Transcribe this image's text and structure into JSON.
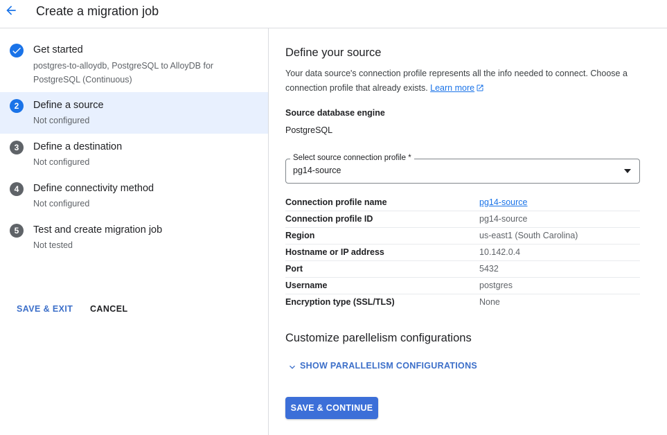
{
  "header": {
    "title": "Create a migration job"
  },
  "stepper": {
    "steps": [
      {
        "number": "",
        "title": "Get started",
        "subtitle": "postgres-to-alloydb, PostgreSQL to AlloyDB for PostgreSQL (Continuous)",
        "state": "done"
      },
      {
        "number": "2",
        "title": "Define a source",
        "subtitle": "Not configured",
        "state": "active"
      },
      {
        "number": "3",
        "title": "Define a destination",
        "subtitle": "Not configured",
        "state": "pending"
      },
      {
        "number": "4",
        "title": "Define connectivity method",
        "subtitle": "Not configured",
        "state": "pending"
      },
      {
        "number": "5",
        "title": "Test and create migration job",
        "subtitle": "Not tested",
        "state": "pending"
      }
    ],
    "save_exit_label": "SAVE & EXIT",
    "cancel_label": "CANCEL"
  },
  "main": {
    "section_title": "Define your source",
    "description": "Your data source's connection profile represents all the info needed to connect. Choose a connection profile that already exists.",
    "learn_more": "Learn more",
    "engine_label": "Source database engine",
    "engine_value": "PostgreSQL",
    "profile_select": {
      "label": "Select source connection profile *",
      "value": "pg14-source"
    },
    "details": [
      {
        "key": "Connection profile name",
        "value": "pg14-source"
      },
      {
        "key": "Connection profile ID",
        "value": "pg14-source"
      },
      {
        "key": "Region",
        "value": "us-east1 (South Carolina)"
      },
      {
        "key": "Hostname or IP address",
        "value": "10.142.0.4"
      },
      {
        "key": "Port",
        "value": "5432"
      },
      {
        "key": "Username",
        "value": "postgres"
      },
      {
        "key": "Encryption type (SSL/TLS)",
        "value": "None"
      }
    ],
    "parallelism_title": "Customize parellelism configurations",
    "show_parallelism_label": "SHOW PARALLELISM CONFIGURATIONS",
    "save_continue_label": "SAVE & CONTINUE"
  },
  "colors": {
    "accent": "#1a73e8",
    "active_step_bg": "#e8f0fe",
    "primary_button": "#3c6fd8"
  },
  "icons": [
    "arrow-back-icon",
    "check-icon",
    "external-link-icon",
    "dropdown-arrow-icon",
    "chevron-down-icon"
  ]
}
